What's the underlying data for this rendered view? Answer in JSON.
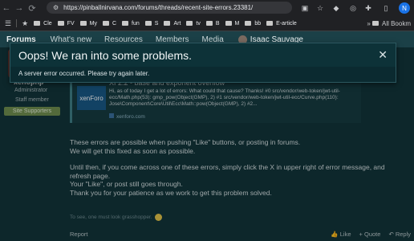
{
  "browser": {
    "url": "https://pinballnirvana.com/forums/threads/recent-site-errors.23381/",
    "bookmarks": [
      "Cle",
      "FV",
      "My",
      "C",
      "fun",
      "S",
      "Art",
      "tv",
      "B",
      "M",
      "bb",
      "E-article"
    ],
    "all_bookmarks_label": "All Bookm",
    "profile_initial": "N"
  },
  "sitenav": {
    "items": [
      "Forums",
      "What's new",
      "Resources",
      "Members",
      "Media"
    ],
    "user_name": "Isaac Sauvage"
  },
  "author": {
    "name": "xenophp",
    "role": "Administrator",
    "staff": "Staff member",
    "badge": "Site Supporters"
  },
  "embed": {
    "logo_text": "xenForo",
    "title": "Xf 2.2 - base and exponent overflow",
    "description": "Hi, as of today I get a lot of errors: What could that cause? Thanks! #0 src/vendor/web-token/jwt-util-ecc/Math.php(53): gmp_pow(Object(GMP), 2) #1 src/vendor/web-token/jwt-util-ecc/Curve.php(110): Jose\\Component\\Core\\Util\\Ecc\\Math::pow(Object(GMP), 2) #2...",
    "source": "xenforo.com"
  },
  "message": {
    "line1": "These errors are possible when pushing \"Like\" buttons, or posting in forums.",
    "line2": "We will get this fixed as soon as possible.",
    "line3": "Until then, if you come across one of these errors, simply click the X in upper right of error message, and refresh page.",
    "line4": "Your \"Like\", or post still goes through.",
    "line5": "Thank you for your patience as we work to get this problem solved."
  },
  "signature": "To see, one must look grasshopper.",
  "actions": {
    "report": "Report",
    "like": "Like",
    "quote": "+ Quote",
    "reply": "Reply"
  },
  "modal": {
    "title": "Oops! We ran into some problems.",
    "body": "A server error occurred. Please try again later.",
    "close": "✕"
  }
}
